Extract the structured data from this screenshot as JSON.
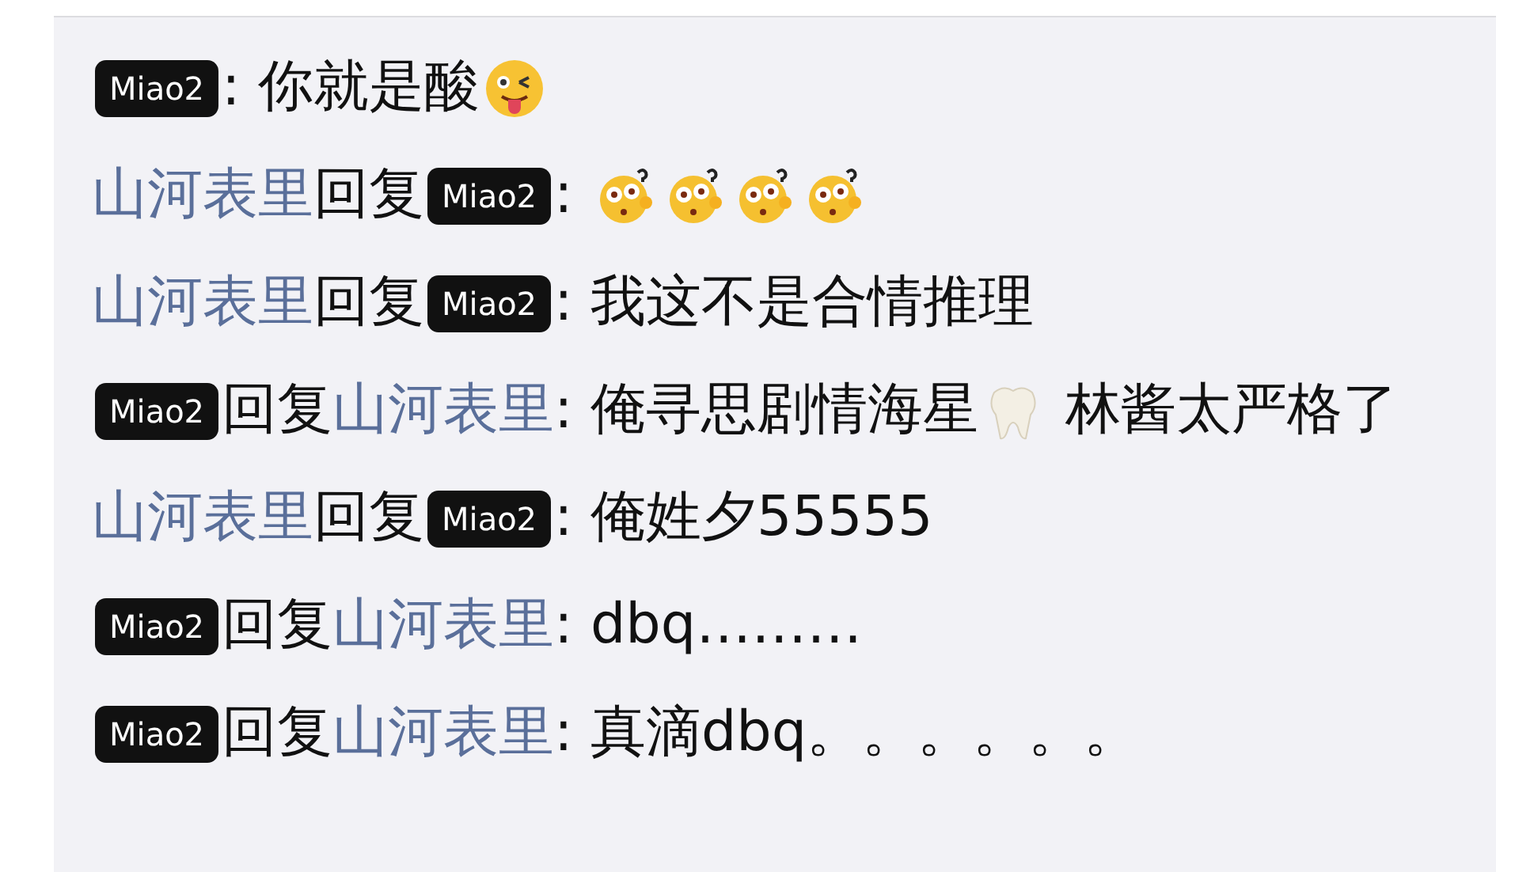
{
  "comments": [
    {
      "author": {
        "kind": "badge",
        "text": "Miao2"
      },
      "parts": [
        {
          "kind": "text",
          "text": ": 你就是酸"
        },
        {
          "kind": "wink"
        }
      ]
    },
    {
      "author": {
        "kind": "name",
        "text": "山河表里"
      },
      "verb": "回复",
      "target": {
        "kind": "badge",
        "text": "Miao2"
      },
      "parts": [
        {
          "kind": "text",
          "text": ": "
        },
        {
          "kind": "puzzled"
        },
        {
          "kind": "puzzled"
        },
        {
          "kind": "puzzled"
        },
        {
          "kind": "puzzled"
        }
      ]
    },
    {
      "author": {
        "kind": "name",
        "text": "山河表里"
      },
      "verb": "回复",
      "target": {
        "kind": "badge",
        "text": "Miao2"
      },
      "parts": [
        {
          "kind": "text",
          "text": ": 我这不是合情推理"
        }
      ]
    },
    {
      "author": {
        "kind": "badge",
        "text": "Miao2"
      },
      "verb": "回复",
      "target": {
        "kind": "name",
        "text": "山河表里"
      },
      "parts": [
        {
          "kind": "text",
          "text": ": 俺寻思剧情海星"
        },
        {
          "kind": "tooth"
        },
        {
          "kind": "text",
          "text": " 林酱太严格了"
        }
      ]
    },
    {
      "author": {
        "kind": "name",
        "text": "山河表里"
      },
      "verb": "回复",
      "target": {
        "kind": "badge",
        "text": "Miao2"
      },
      "parts": [
        {
          "kind": "text",
          "text": ": 俺姓夕55555"
        }
      ]
    },
    {
      "author": {
        "kind": "badge",
        "text": "Miao2"
      },
      "verb": "回复",
      "target": {
        "kind": "name",
        "text": "山河表里"
      },
      "parts": [
        {
          "kind": "text",
          "text": ": dbq………"
        }
      ]
    },
    {
      "author": {
        "kind": "badge",
        "text": "Miao2"
      },
      "verb": "回复",
      "target": {
        "kind": "name",
        "text": "山河表里"
      },
      "parts": [
        {
          "kind": "text",
          "text": ": 真滴dbq。。。。。。"
        }
      ]
    }
  ]
}
